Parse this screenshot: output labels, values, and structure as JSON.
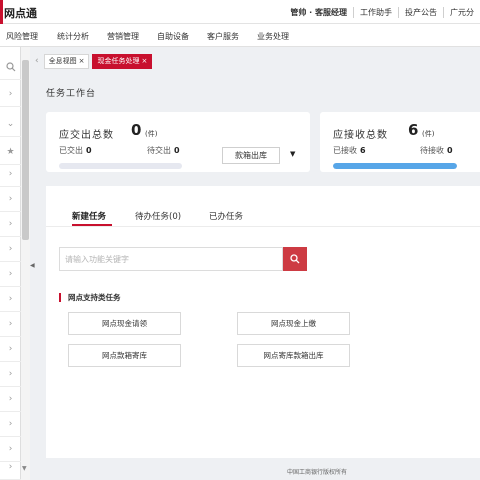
{
  "header": {
    "app_title": "网点通",
    "user_role": "管帅 · 客服经理",
    "links": [
      "工作助手",
      "投产公告",
      "广元分"
    ]
  },
  "nav": {
    "items": [
      "风险管理",
      "统计分析",
      "营销管理",
      "自助设备",
      "客户服务",
      "业务处理"
    ]
  },
  "page_tabs": [
    {
      "label": "全息视图",
      "active": false
    },
    {
      "label": "现金任务处理",
      "active": true
    }
  ],
  "workbench": {
    "title": "任务工作台",
    "submit_card": {
      "title": "应交出总数",
      "total": "0",
      "unit": "(件)",
      "done_label": "已交出",
      "done_value": "0",
      "pending_label": "待交出",
      "pending_value": "0",
      "select_value": "款箱出库",
      "progress_fraction": 0
    },
    "receive_card": {
      "title": "应接收总数",
      "total": "6",
      "unit": "(件)",
      "done_label": "已接收",
      "done_value": "6",
      "pending_label": "待接收",
      "pending_value": "0",
      "progress_fraction": 1
    }
  },
  "task_tabs": [
    {
      "label": "新建任务",
      "active": true
    },
    {
      "label": "待办任务(0)",
      "active": false
    },
    {
      "label": "已办任务",
      "active": false
    }
  ],
  "search": {
    "placeholder": "请输入功能关键字",
    "value": ""
  },
  "section": {
    "title": "网点支持类任务",
    "buttons": [
      "网点现金请领",
      "网点现金上缴",
      "网点款箱寄库",
      "网点寄库款箱出库"
    ]
  },
  "footer": {
    "copyright": "中国工商银行版权所有"
  },
  "colors": {
    "brand_red": "#c8102e",
    "progress_blue": "#57a6e8"
  }
}
